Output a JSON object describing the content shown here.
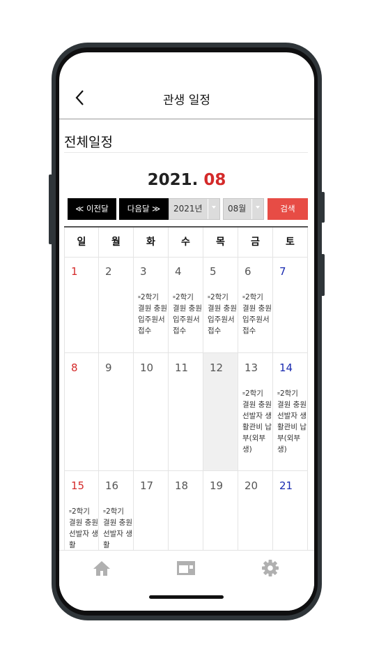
{
  "header": {
    "title": "관생 일정",
    "back_icon": "chevron-left-icon"
  },
  "section_title": "전체일정",
  "period": {
    "year_text": "2021.",
    "month_text": "08"
  },
  "controls": {
    "prev_label": "≪ 이전달",
    "next_label": "다음달 ≫",
    "year_select": "2021년",
    "month_select": "08월",
    "search_label": "검색"
  },
  "weekdays": [
    "일",
    "월",
    "화",
    "수",
    "목",
    "금",
    "토"
  ],
  "weeks": [
    [
      {
        "day": "1"
      },
      {
        "day": "2"
      },
      {
        "day": "3",
        "event": "2학기 결원 충원 입주원서 접수"
      },
      {
        "day": "4",
        "event": "2학기 결원 충원 입주원서 접수"
      },
      {
        "day": "5",
        "event": "2학기 결원 충원 입주원서 접수"
      },
      {
        "day": "6",
        "event": "2학기 결원 충원 입주원서 접수"
      },
      {
        "day": "7"
      }
    ],
    [
      {
        "day": "8"
      },
      {
        "day": "9"
      },
      {
        "day": "10"
      },
      {
        "day": "11"
      },
      {
        "day": "12",
        "today": true
      },
      {
        "day": "13",
        "event": "2학기 결원 충원 선발자 생활관비 납부(외부생)"
      },
      {
        "day": "14",
        "event": "2학기 결원 충원 선발자 생활관비 납부(외부생)"
      }
    ],
    [
      {
        "day": "15",
        "event": "2학기 결원 충원 선발자 생활"
      },
      {
        "day": "16",
        "event": "2학기 결원 충원 선발자 생활"
      },
      {
        "day": "17"
      },
      {
        "day": "18"
      },
      {
        "day": "19"
      },
      {
        "day": "20"
      },
      {
        "day": "21"
      }
    ]
  ],
  "event_bullet": "⌗",
  "nav": {
    "items": [
      "home-icon",
      "board-icon",
      "gear-icon"
    ]
  },
  "colors": {
    "sunday": "#d42a2a",
    "saturday": "#1a2bb0",
    "search": "#e74c45"
  }
}
